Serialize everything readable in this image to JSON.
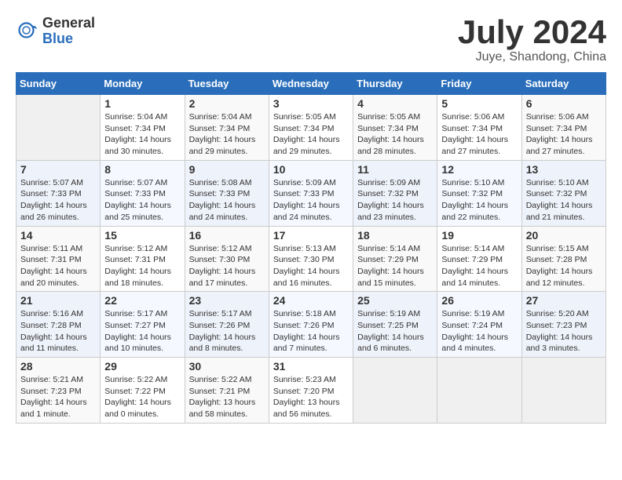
{
  "header": {
    "logo_general": "General",
    "logo_blue": "Blue",
    "month_year": "July 2024",
    "location": "Juye, Shandong, China"
  },
  "days_of_week": [
    "Sunday",
    "Monday",
    "Tuesday",
    "Wednesday",
    "Thursday",
    "Friday",
    "Saturday"
  ],
  "weeks": [
    [
      {
        "num": "",
        "empty": true
      },
      {
        "num": "1",
        "rise": "5:04 AM",
        "set": "7:34 PM",
        "daylight": "14 hours and 30 minutes."
      },
      {
        "num": "2",
        "rise": "5:04 AM",
        "set": "7:34 PM",
        "daylight": "14 hours and 29 minutes."
      },
      {
        "num": "3",
        "rise": "5:05 AM",
        "set": "7:34 PM",
        "daylight": "14 hours and 29 minutes."
      },
      {
        "num": "4",
        "rise": "5:05 AM",
        "set": "7:34 PM",
        "daylight": "14 hours and 28 minutes."
      },
      {
        "num": "5",
        "rise": "5:06 AM",
        "set": "7:34 PM",
        "daylight": "14 hours and 27 minutes."
      },
      {
        "num": "6",
        "rise": "5:06 AM",
        "set": "7:34 PM",
        "daylight": "14 hours and 27 minutes."
      }
    ],
    [
      {
        "num": "7",
        "rise": "5:07 AM",
        "set": "7:33 PM",
        "daylight": "14 hours and 26 minutes."
      },
      {
        "num": "8",
        "rise": "5:07 AM",
        "set": "7:33 PM",
        "daylight": "14 hours and 25 minutes."
      },
      {
        "num": "9",
        "rise": "5:08 AM",
        "set": "7:33 PM",
        "daylight": "14 hours and 24 minutes."
      },
      {
        "num": "10",
        "rise": "5:09 AM",
        "set": "7:33 PM",
        "daylight": "14 hours and 24 minutes."
      },
      {
        "num": "11",
        "rise": "5:09 AM",
        "set": "7:32 PM",
        "daylight": "14 hours and 23 minutes."
      },
      {
        "num": "12",
        "rise": "5:10 AM",
        "set": "7:32 PM",
        "daylight": "14 hours and 22 minutes."
      },
      {
        "num": "13",
        "rise": "5:10 AM",
        "set": "7:32 PM",
        "daylight": "14 hours and 21 minutes."
      }
    ],
    [
      {
        "num": "14",
        "rise": "5:11 AM",
        "set": "7:31 PM",
        "daylight": "14 hours and 20 minutes."
      },
      {
        "num": "15",
        "rise": "5:12 AM",
        "set": "7:31 PM",
        "daylight": "14 hours and 18 minutes."
      },
      {
        "num": "16",
        "rise": "5:12 AM",
        "set": "7:30 PM",
        "daylight": "14 hours and 17 minutes."
      },
      {
        "num": "17",
        "rise": "5:13 AM",
        "set": "7:30 PM",
        "daylight": "14 hours and 16 minutes."
      },
      {
        "num": "18",
        "rise": "5:14 AM",
        "set": "7:29 PM",
        "daylight": "14 hours and 15 minutes."
      },
      {
        "num": "19",
        "rise": "5:14 AM",
        "set": "7:29 PM",
        "daylight": "14 hours and 14 minutes."
      },
      {
        "num": "20",
        "rise": "5:15 AM",
        "set": "7:28 PM",
        "daylight": "14 hours and 12 minutes."
      }
    ],
    [
      {
        "num": "21",
        "rise": "5:16 AM",
        "set": "7:28 PM",
        "daylight": "14 hours and 11 minutes."
      },
      {
        "num": "22",
        "rise": "5:17 AM",
        "set": "7:27 PM",
        "daylight": "14 hours and 10 minutes."
      },
      {
        "num": "23",
        "rise": "5:17 AM",
        "set": "7:26 PM",
        "daylight": "14 hours and 8 minutes."
      },
      {
        "num": "24",
        "rise": "5:18 AM",
        "set": "7:26 PM",
        "daylight": "14 hours and 7 minutes."
      },
      {
        "num": "25",
        "rise": "5:19 AM",
        "set": "7:25 PM",
        "daylight": "14 hours and 6 minutes."
      },
      {
        "num": "26",
        "rise": "5:19 AM",
        "set": "7:24 PM",
        "daylight": "14 hours and 4 minutes."
      },
      {
        "num": "27",
        "rise": "5:20 AM",
        "set": "7:23 PM",
        "daylight": "14 hours and 3 minutes."
      }
    ],
    [
      {
        "num": "28",
        "rise": "5:21 AM",
        "set": "7:23 PM",
        "daylight": "14 hours and 1 minute."
      },
      {
        "num": "29",
        "rise": "5:22 AM",
        "set": "7:22 PM",
        "daylight": "14 hours and 0 minutes."
      },
      {
        "num": "30",
        "rise": "5:22 AM",
        "set": "7:21 PM",
        "daylight": "13 hours and 58 minutes."
      },
      {
        "num": "31",
        "rise": "5:23 AM",
        "set": "7:20 PM",
        "daylight": "13 hours and 56 minutes."
      },
      {
        "num": "",
        "empty": true
      },
      {
        "num": "",
        "empty": true
      },
      {
        "num": "",
        "empty": true
      }
    ]
  ]
}
